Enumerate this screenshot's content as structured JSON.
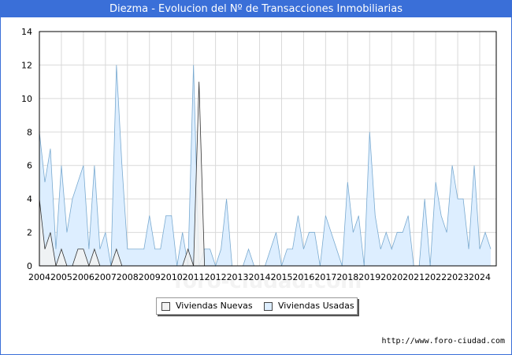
{
  "title": "Diezma - Evolucion del Nº de Transacciones Inmobiliarias",
  "watermark": "foro-ciudad.com",
  "url": "http://www.foro-ciudad.com",
  "chart_data": {
    "type": "area",
    "title": "Diezma - Evolucion del Nº de Transacciones Inmobiliarias",
    "xlabel": "",
    "ylabel": "",
    "ylim": [
      0,
      14
    ],
    "yticks": [
      0,
      2,
      4,
      6,
      8,
      10,
      12,
      14
    ],
    "xlim": [
      2004,
      2024.75
    ],
    "xticks": [
      "2004",
      "2005",
      "2006",
      "2007",
      "2008",
      "2009",
      "2010",
      "2011",
      "2012",
      "2013",
      "2014",
      "2015",
      "2016",
      "2017",
      "2018",
      "2019",
      "2020",
      "2021",
      "2022",
      "2023",
      "2024"
    ],
    "grid": true,
    "legend_position": "bottom",
    "x_start": 2004,
    "x_step": 0.25,
    "series": [
      {
        "name": "Viviendas Nuevas",
        "color": "#f2f2f2",
        "stroke": "#333333",
        "values": [
          4,
          1,
          2,
          0,
          1,
          0,
          0,
          1,
          1,
          0,
          1,
          0,
          0,
          0,
          1,
          0,
          0,
          0,
          0,
          0,
          0,
          0,
          0,
          0,
          0,
          0,
          0,
          1,
          0,
          11,
          0,
          0,
          0,
          0,
          0,
          0,
          0,
          0,
          0,
          0,
          0,
          0,
          0,
          0,
          0,
          0,
          0,
          0,
          0,
          0,
          0,
          0,
          0,
          0,
          0,
          0,
          0,
          0,
          0,
          0,
          0,
          0,
          0,
          0,
          0,
          0,
          0,
          0,
          0,
          0,
          0,
          0,
          0,
          0,
          0,
          0,
          0,
          0,
          0,
          0,
          0,
          0,
          0
        ]
      },
      {
        "name": "Viviendas Usadas",
        "color": "#ddeeff",
        "stroke": "#7aaad0",
        "values": [
          8,
          5,
          7,
          1,
          6,
          2,
          4,
          5,
          6,
          1,
          6,
          1,
          2,
          0,
          12,
          6,
          1,
          1,
          1,
          1,
          3,
          1,
          1,
          3,
          3,
          0,
          2,
          0,
          12,
          0,
          1,
          1,
          0,
          1,
          4,
          0,
          0,
          0,
          1,
          0,
          0,
          0,
          1,
          2,
          0,
          1,
          1,
          3,
          1,
          2,
          2,
          0,
          3,
          2,
          1,
          0,
          5,
          2,
          3,
          0,
          8,
          3,
          1,
          2,
          1,
          2,
          2,
          3,
          0,
          0,
          4,
          0,
          5,
          3,
          2,
          6,
          4,
          4,
          1,
          6,
          1,
          2,
          1
        ]
      }
    ]
  }
}
